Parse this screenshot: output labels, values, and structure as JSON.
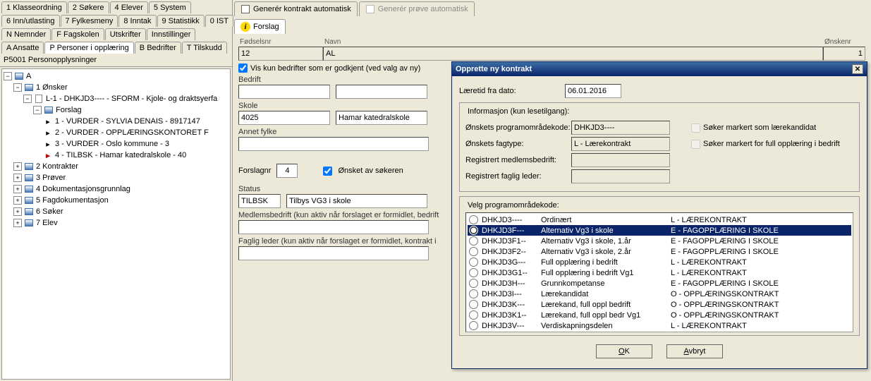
{
  "tabs": {
    "row1": [
      "1 Klasseordning",
      "2 Søkere",
      "4 Elever",
      "5 System"
    ],
    "row2": [
      "6 Inn/utlasting",
      "7 Fylkesmeny",
      "8 Inntak",
      "9 Statistikk",
      "0 IST"
    ],
    "row3": [
      "N Nemnder",
      "F Fagskolen",
      "Utskrifter",
      "Innstillinger"
    ],
    "row4": [
      "A Ansatte",
      "P Personer i opplæring",
      "B Bedrifter",
      "T Tilskudd"
    ]
  },
  "tree": {
    "title": "P5001 Personopplysninger",
    "root": "A",
    "n1": "1 Ønsker",
    "n1a": "L-1 - DHKJD3---- - SFORM - Kjole- og draktsyerfa",
    "n1b": "Forslag",
    "n1b1": "1 - VURDER - SYLVIA DENAIS - 8917147",
    "n1b2": "2 - VURDER - OPPLÆRINGSKONTORET F",
    "n1b3": "3 - VURDER - Oslo kommune - 3",
    "n1b4": "4 - TILBSK - Hamar katedralskole - 40",
    "n2": "2 Kontrakter",
    "n3": "3 Prøver",
    "n4": "4 Dokumentasjonsgrunnlag",
    "n5": "5 Fagdokumentasjon",
    "n6": "6 Søker",
    "n7": "7 Elev"
  },
  "toptabs": {
    "t1": "Generér kontrakt automatisk",
    "t2": "Generér prøve automatisk",
    "t3": "Forslag"
  },
  "header": {
    "fodselsnr_label": "Fødselsnr",
    "fodselsnr": "12",
    "navn_label": "Navn",
    "navn": "AL",
    "onskenr_label": "Ønskenr",
    "onskenr": "1"
  },
  "form": {
    "vis_kun": "Vis kun bedrifter som er godkjent (ved valg av ny)",
    "bedrift_label": "Bedrift",
    "skole_label": "Skole",
    "skole_code": "4025",
    "skole_name": "Hamar katedralskole",
    "annet_fylke_label": "Annet fylke",
    "forslagnr_label": "Forslagnr",
    "forslagnr": "4",
    "onsket_av": "Ønsket av søkeren",
    "status_label": "Status",
    "status_code": "TILBSK",
    "status_text": "Tilbys VG3 i skole",
    "medlem_label": "Medlemsbedrift (kun aktiv når forslaget er formidlet, bedrift",
    "faglig_label": "Faglig leder (kun aktiv når forslaget er formidlet, kontrakt i"
  },
  "dialog": {
    "title": "Opprette ny kontrakt",
    "laeretid_label": "Læretid fra dato:",
    "laeretid": "06.01.2016",
    "info_legend": "Informasjon (kun lesetilgang):",
    "onsket_prog_label": "Ønskets programområdekode:",
    "onsket_prog": "DHKJD3----",
    "onsket_fagtype_label": "Ønskets fagtype:",
    "onsket_fagtype": "L - Lærekontrakt",
    "reg_medlem_label": "Registrert medlemsbedrift:",
    "reg_faglig_label": "Registrert faglig leder:",
    "chk_laere": "Søker markert som lærekandidat",
    "chk_full": "Søker markert for full opplæring i bedrift",
    "velg_legend": "Velg programområdekode:",
    "radios": [
      {
        "code": "DHKJD3----",
        "desc": "Ordinært",
        "type": "L - LÆREKONTRAKT"
      },
      {
        "code": "DHKJD3F---",
        "desc": "Alternativ Vg3 i skole",
        "type": "E - FAGOPPLÆRING I SKOLE"
      },
      {
        "code": "DHKJD3F1--",
        "desc": "Alternativ Vg3 i skole, 1.år",
        "type": "E - FAGOPPLÆRING I SKOLE"
      },
      {
        "code": "DHKJD3F2--",
        "desc": "Alternativ Vg3 i skole, 2.år",
        "type": "E - FAGOPPLÆRING I SKOLE"
      },
      {
        "code": "DHKJD3G---",
        "desc": "Full opplæring i bedrift",
        "type": "L - LÆREKONTRAKT"
      },
      {
        "code": "DHKJD3G1--",
        "desc": "Full opplæring i bedrift Vg1",
        "type": "L - LÆREKONTRAKT"
      },
      {
        "code": "DHKJD3H---",
        "desc": "Grunnkompetanse",
        "type": "E - FAGOPPLÆRING I SKOLE"
      },
      {
        "code": "DHKJD3I---",
        "desc": "Lærekandidat",
        "type": "O - OPPLÆRINGSKONTRAKT"
      },
      {
        "code": "DHKJD3K---",
        "desc": "Lærekand, full oppl bedrift",
        "type": "O - OPPLÆRINGSKONTRAKT"
      },
      {
        "code": "DHKJD3K1--",
        "desc": "Lærekand, full oppl bedr Vg1",
        "type": "O - OPPLÆRINGSKONTRAKT"
      },
      {
        "code": "DHKJD3V---",
        "desc": "Verdiskapningsdelen",
        "type": "L - LÆREKONTRAKT"
      }
    ],
    "ok": "OK",
    "avbryt": "Avbryt"
  }
}
